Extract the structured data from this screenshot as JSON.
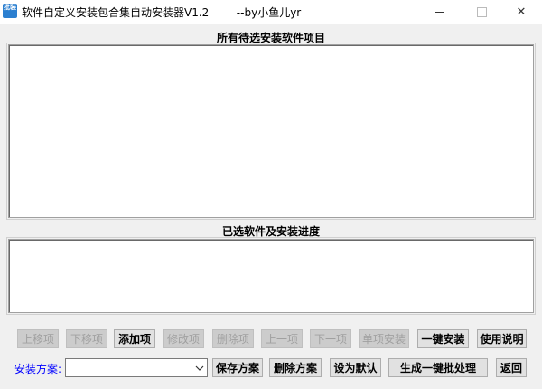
{
  "window": {
    "title": "软件自定义安装包合集自动安装器V1.2        --by小鱼儿yr",
    "app_icon_glyph": "批装",
    "minimize_icon": "minimize-icon",
    "maximize_icon": "maximize-icon",
    "close_icon": "close-icon",
    "close_glyph": "✕"
  },
  "all_software": {
    "label": "所有待选安装软件项目"
  },
  "selected_software": {
    "label": "已选软件及安装进度"
  },
  "toolbar": {
    "move_up": "上移项",
    "move_down": "下移项",
    "add_item": "添加项",
    "edit_item": "修改项",
    "delete_item": "删除项",
    "prev_item": "上一项",
    "next_item": "下一项",
    "single_install": "单项安装",
    "one_click_install": "一键安装",
    "help": "使用说明"
  },
  "scheme": {
    "label": "安装方案:",
    "selected_value": "",
    "save": "保存方案",
    "delete": "删除方案",
    "set_default": "设为默认",
    "generate_batch": "生成一键批处理",
    "back": "返回"
  },
  "colors": {
    "scheme_label": "#0000ff",
    "disabled_text": "#a0a0a0",
    "app_icon": "#2b7fd0"
  }
}
